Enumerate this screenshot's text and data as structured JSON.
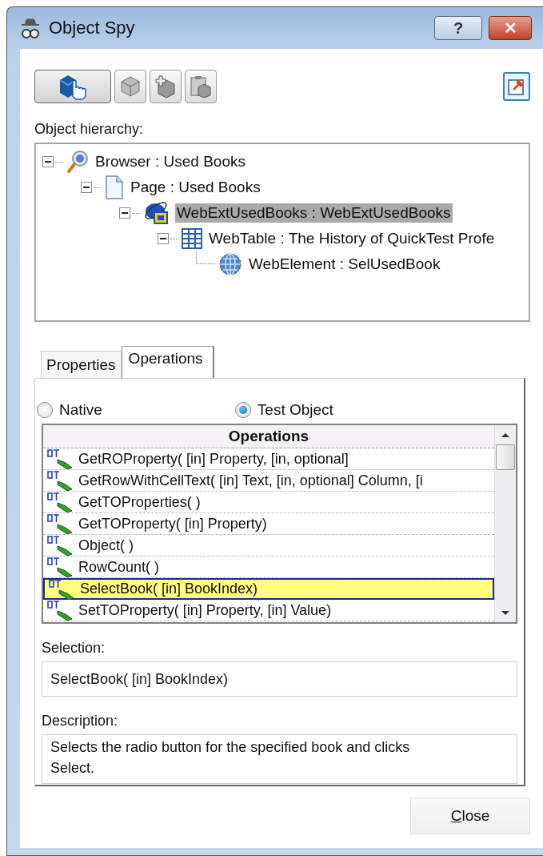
{
  "window": {
    "title": "Object Spy",
    "help_button": "?",
    "close_button": "✕"
  },
  "toolbar": {
    "buttons": [
      {
        "kind": "pointing-hand",
        "selected": true
      },
      {
        "kind": "cube",
        "selected": false
      },
      {
        "kind": "cube-plus",
        "selected": false
      },
      {
        "kind": "clipboard",
        "selected": false
      }
    ]
  },
  "hierarchy": {
    "label": "Object hierarchy:",
    "tree": [
      {
        "label": "Browser : Used Books",
        "kind": "browser",
        "expanded": true,
        "selected": false,
        "children": [
          {
            "label": "Page : Used Books",
            "kind": "page",
            "expanded": true,
            "selected": false,
            "children": [
              {
                "label": "WebExtUsedBooks : WebExtUsedBooks",
                "kind": "extension",
                "expanded": true,
                "selected": true,
                "children": [
                  {
                    "label": "WebTable : The History of QuickTest Profe",
                    "kind": "table",
                    "expanded": true,
                    "selected": false,
                    "children": [
                      {
                        "label": "WebElement : SelUsedBook",
                        "kind": "element",
                        "selected": false
                      }
                    ]
                  }
                ]
              }
            ]
          }
        ]
      }
    ]
  },
  "tabs": [
    {
      "label": "Properties",
      "selected": false
    },
    {
      "label": "Operations",
      "selected": true
    }
  ],
  "radios": [
    {
      "label": "Native",
      "selected": false
    },
    {
      "label": "Test Object",
      "selected": true
    }
  ],
  "operations": {
    "header": "Operations",
    "rows": [
      {
        "text": "GetROProperty( [in] Property, [in, optional]",
        "selected": false
      },
      {
        "text": "GetRowWithCellText( [in] Text, [in, optional] Column, [i",
        "selected": false
      },
      {
        "text": "GetTOProperties( )",
        "selected": false
      },
      {
        "text": "GetTOProperty( [in] Property)",
        "selected": false
      },
      {
        "text": "Object( )",
        "selected": false
      },
      {
        "text": "RowCount( )",
        "selected": false
      },
      {
        "text": "SelectBook( [in] BookIndex)",
        "selected": true
      },
      {
        "text": "SetTOProperty( [in] Property, [in] Value)",
        "selected": false
      }
    ]
  },
  "selection": {
    "label": "Selection:",
    "value": "SelectBook( [in] BookIndex)"
  },
  "description": {
    "label": "Description:",
    "value": "Selects the radio button for the specified book and clicks Select."
  },
  "footer": {
    "close_button": "Close"
  }
}
